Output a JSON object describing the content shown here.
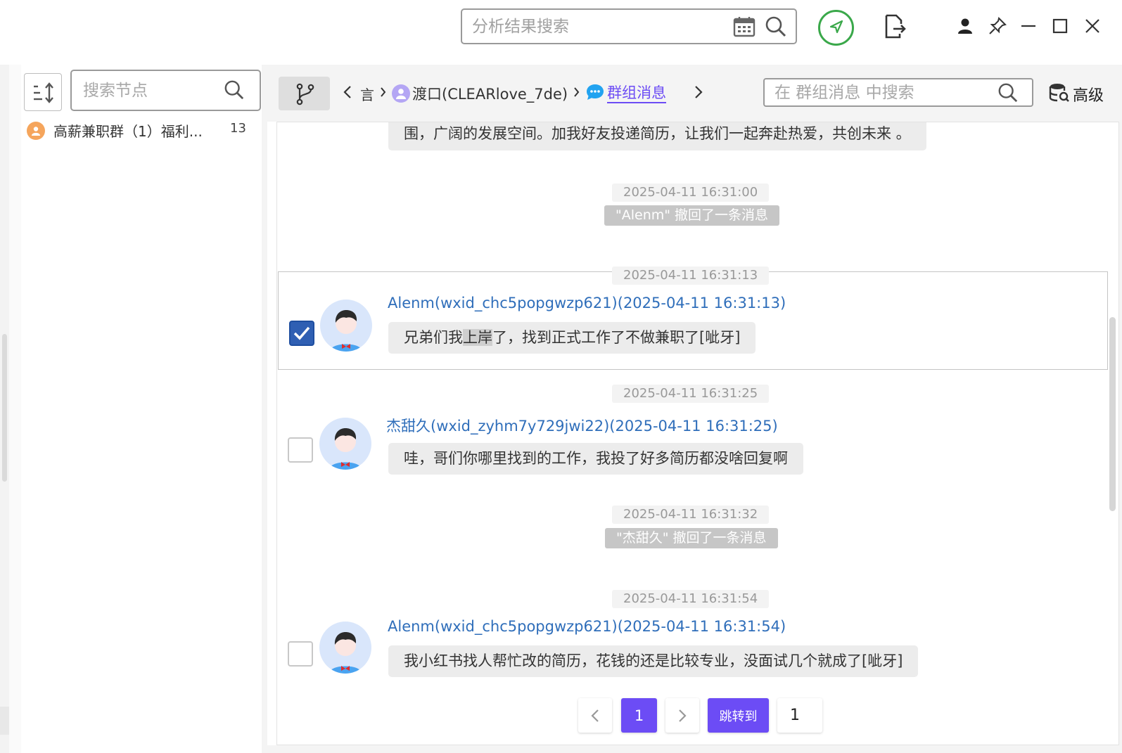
{
  "topbar": {
    "search_placeholder": "分析结果搜索",
    "icons": [
      "calendar-icon",
      "search-icon",
      "rocket-icon",
      "export-icon",
      "user-icon",
      "pin-icon",
      "minimize-icon",
      "maximize-icon",
      "close-icon"
    ]
  },
  "left_panel": {
    "search_placeholder": "搜索节点",
    "tree": [
      {
        "label": "高薪兼职群（1）福利...",
        "count": "13"
      }
    ]
  },
  "main": {
    "breadcrumb": {
      "crumbs": [
        "言",
        "渡口(CLEARlove_7de)",
        "群组消息"
      ]
    },
    "search_placeholder": "在 群组消息 中搜索",
    "advanced_label": "高级",
    "messages": {
      "top_partial_text": "围，广阔的发展空间。加我好友投递简历，让我们一起奔赴热爱，共创未来 。",
      "ts1": "2025-04-11 16:31:00",
      "recall1": "\"Alenm\" 撤回了一条消息",
      "ts2": "2025-04-11 16:31:13",
      "m2_sender": "Alenm(wxid_chc5popgwzp621)(2025-04-11 16:31:13)",
      "m2_text_a": "兄弟们我",
      "m2_text_hl": "上岸",
      "m2_text_b": "了，找到正式工作了不做兼职了[呲牙]",
      "ts3": "2025-04-11 16:31:25",
      "m3_sender": "杰甜久(wxid_zyhm7y729jwi22)(2025-04-11 16:31:25)",
      "m3_text": "哇，哥们你哪里找到的工作，我投了好多简历都没啥回复啊",
      "ts4": "2025-04-11 16:31:32",
      "recall2": "\"杰甜久\" 撤回了一条消息",
      "ts5": "2025-04-11 16:31:54",
      "m5_sender": "Alenm(wxid_chc5popgwzp621)(2025-04-11 16:31:54)",
      "m5_text": "我小红书找人帮忙改的简历，花钱的还是比较专业，没面试几个就成了[呲牙]"
    }
  },
  "pagination": {
    "current_page": "1",
    "jump_label": "跳转到",
    "jump_value": "1"
  },
  "colors": {
    "accent": "#6c4cf5",
    "link": "#2f6eba",
    "rocket_ring": "#3aa84a",
    "checked": "#2f5fb3"
  }
}
